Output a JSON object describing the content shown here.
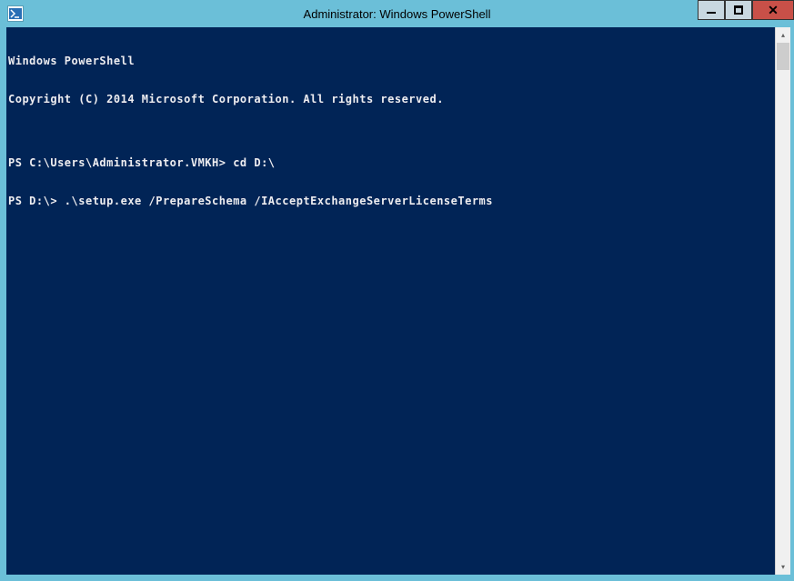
{
  "window": {
    "title": "Administrator: Windows PowerShell",
    "icon_label": "powershell-icon"
  },
  "terminal": {
    "lines": [
      "Windows PowerShell",
      "Copyright (C) 2014 Microsoft Corporation. All rights reserved.",
      "",
      "PS C:\\Users\\Administrator.VMKH> cd D:\\",
      "PS D:\\> .\\setup.exe /PrepareSchema /IAcceptExchangeServerLicenseTerms"
    ]
  }
}
